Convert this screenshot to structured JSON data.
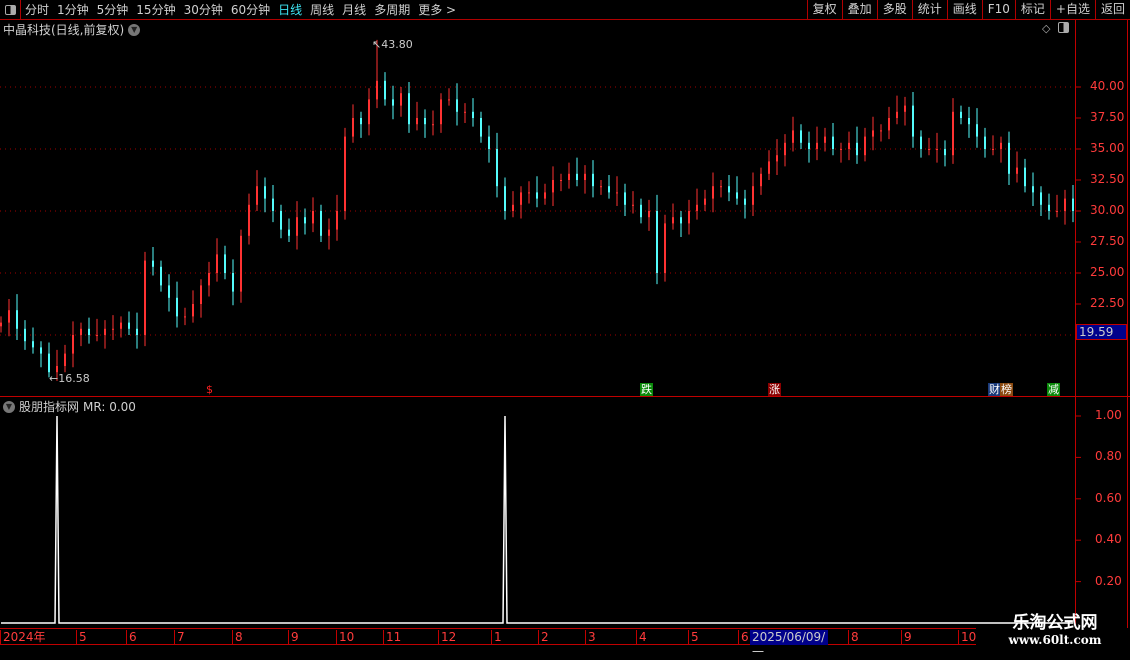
{
  "toolbar": {
    "periods": [
      "分时",
      "1分钟",
      "5分钟",
      "15分钟",
      "30分钟",
      "60分钟",
      "日线",
      "周线",
      "月线",
      "多周期",
      "更多 >"
    ],
    "active_period": "日线",
    "right_buttons": [
      "复权",
      "叠加",
      "多股",
      "统计",
      "画线",
      "F10",
      "标记",
      "+自选",
      "返回"
    ]
  },
  "main_panel": {
    "title": "中晶科技(日线,前复权)",
    "price_labels": [
      "40.00",
      "37.50",
      "35.00",
      "32.50",
      "30.00",
      "27.50",
      "25.00",
      "22.50"
    ],
    "current_price": "19.59",
    "max_label": "43.80",
    "min_label": "16.58",
    "markers": [
      {
        "text": "$",
        "bg": "transparent",
        "color": "#ff2020"
      },
      {
        "text": "跌",
        "bg": "#0a8a0a",
        "color": "#ffffff"
      },
      {
        "text": "涨",
        "bg": "#8b0000",
        "color": "#ffffff"
      },
      {
        "text": "财",
        "bg": "#1a3a7a",
        "color": "#ffffff"
      },
      {
        "text": "榜",
        "bg": "#8b4a10",
        "color": "#ffffff"
      },
      {
        "text": "减",
        "bg": "#0a8a0a",
        "color": "#ffffff"
      }
    ]
  },
  "indicator_panel": {
    "title": "股朋指标网",
    "value_text": "MR: 0.00",
    "labels": [
      "1.00",
      "0.80",
      "0.60",
      "0.40",
      "0.20"
    ]
  },
  "time_axis": {
    "labels": [
      "2024年",
      "5",
      "6",
      "7",
      "8",
      "9",
      "10",
      "11",
      "12",
      "1",
      "2",
      "3",
      "4",
      "5",
      "6",
      "8",
      "9",
      "10"
    ],
    "cursor_date": "2025/06/09/一"
  },
  "watermark": {
    "name": "乐淘公式网",
    "url": "www.60lt.com"
  },
  "colors": {
    "up": "#ff3232",
    "down": "#54fcfc",
    "axis": "#c00000",
    "grid": "#a00000"
  },
  "chart_data": {
    "type": "candlestick",
    "ylim": [
      16.58,
      43.8
    ],
    "yticks": [
      22.5,
      25,
      27.5,
      30,
      32.5,
      35,
      37.5,
      40
    ],
    "price_high": 43.8,
    "price_low": 16.58,
    "closes": [
      21,
      22,
      20.5,
      19.5,
      19,
      18.5,
      17,
      17.5,
      18.5,
      20,
      20.5,
      20,
      20,
      20.5,
      20.5,
      21,
      20.5,
      20,
      26,
      25.5,
      24,
      23,
      21.5,
      21.5,
      22.5,
      24,
      25,
      26.5,
      25,
      23.5,
      28,
      30.5,
      32,
      31,
      30,
      28.5,
      28,
      29.5,
      29,
      30,
      28,
      28.5,
      30,
      36,
      37.5,
      37,
      39,
      40.5,
      39,
      38.5,
      39.5,
      37,
      37.5,
      37,
      37,
      39,
      39,
      38,
      38,
      37.5,
      36,
      35,
      32,
      30,
      30.5,
      31.5,
      31.5,
      31,
      31.5,
      32.5,
      32.5,
      33,
      32.5,
      33,
      32,
      32,
      31.5,
      31.5,
      30.5,
      30.5,
      29.5,
      30,
      25,
      29,
      29.5,
      29,
      30,
      30.5,
      31,
      32,
      32,
      31.5,
      31,
      30.5,
      32,
      33,
      34,
      34.5,
      35.5,
      36.5,
      35.5,
      35,
      35.5,
      36,
      35,
      35,
      35.5,
      34.5,
      36,
      36.5,
      36.5,
      37.5,
      38,
      38.5,
      36,
      35,
      35,
      35,
      34.5,
      38,
      37.5,
      37,
      36,
      35,
      35,
      35.5,
      33,
      33.5,
      32,
      31.5,
      30.5,
      30,
      30,
      31,
      30
    ],
    "indicator": {
      "name": "MR",
      "ylim": [
        0,
        1
      ],
      "spikes": [
        {
          "bar": 7,
          "value": 1.0
        },
        {
          "bar": 63,
          "value": 1.0
        }
      ]
    }
  }
}
